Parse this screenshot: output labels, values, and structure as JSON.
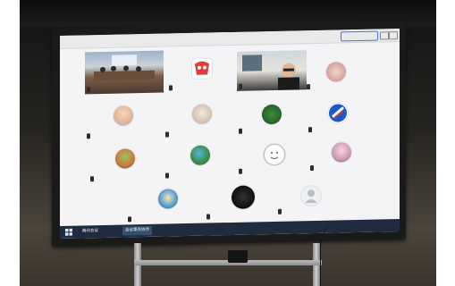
{
  "screen": {
    "window_title": "",
    "top_button_label": "",
    "taskbar": {
      "apps": [
        {
          "label": "腾讯会议"
        },
        {
          "label": "会议事务协作"
        }
      ]
    },
    "participants": [
      {
        "name": "",
        "kind": "video-room"
      },
      {
        "name": "",
        "kind": "avatar-red-logo"
      },
      {
        "name": "",
        "kind": "video-person"
      },
      {
        "name": "",
        "kind": "avatar-portrait"
      },
      {
        "name": "",
        "kind": "avatar-baby"
      },
      {
        "name": "",
        "kind": "avatar-elder"
      },
      {
        "name": "",
        "kind": "avatar-tree"
      },
      {
        "name": "",
        "kind": "avatar-swirl-blue"
      },
      {
        "name": "",
        "kind": "avatar-landscape"
      },
      {
        "name": "",
        "kind": "avatar-green-blue"
      },
      {
        "name": "",
        "kind": "avatar-smiley"
      },
      {
        "name": "",
        "kind": "avatar-lady"
      },
      {
        "name": "",
        "kind": "avatar-cartoon"
      },
      {
        "name": "",
        "kind": "avatar-dark"
      },
      {
        "name": "",
        "kind": "avatar-default"
      }
    ]
  }
}
